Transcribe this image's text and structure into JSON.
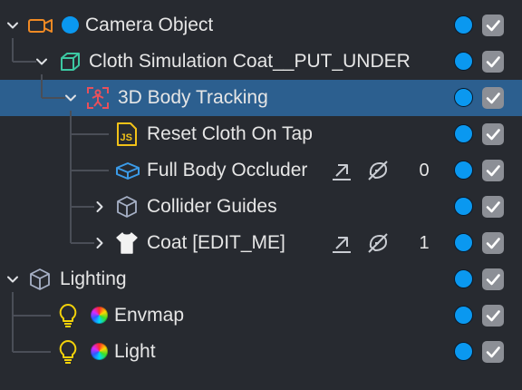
{
  "hierarchy": [
    {
      "name": "Camera Object",
      "level": 0,
      "expand": "open",
      "icon": "camera-icon",
      "name_dot": "#0a98f0",
      "visible": true,
      "enabled": true,
      "selected": false
    },
    {
      "name": "Cloth Simulation Coat__PUT_UNDER",
      "level": 1,
      "expand": "open",
      "icon": "cube-green-icon",
      "visible": true,
      "enabled": true,
      "selected": false
    },
    {
      "name": "3D Body Tracking",
      "level": 2,
      "expand": "open",
      "icon": "body-tracking-icon",
      "visible": true,
      "enabled": true,
      "selected": true
    },
    {
      "name": "Reset Cloth On Tap",
      "level": 3,
      "expand": "none",
      "icon": "js-script-icon",
      "visible": true,
      "enabled": true,
      "selected": false
    },
    {
      "name": "Full Body Occluder",
      "level": 3,
      "expand": "none",
      "icon": "cube-blue-icon",
      "visible": true,
      "enabled": true,
      "selected": false,
      "tools": true,
      "count": "0"
    },
    {
      "name": "Collider Guides",
      "level": 3,
      "expand": "closed",
      "icon": "cube-outline-icon",
      "visible": true,
      "enabled": true,
      "selected": false
    },
    {
      "name": "Coat [EDIT_ME]",
      "level": 3,
      "expand": "closed",
      "icon": "tshirt-icon",
      "visible": true,
      "enabled": true,
      "selected": false,
      "tools": true,
      "count": "1"
    },
    {
      "name": "Lighting",
      "level": 0,
      "expand": "open",
      "icon": "cube-outline-icon",
      "visible": true,
      "enabled": true,
      "selected": false
    },
    {
      "name": "Envmap",
      "level": 1,
      "expand": "none",
      "icon": "lightbulb-icon",
      "name_dot": "rainbow",
      "visible": true,
      "enabled": true,
      "selected": false
    },
    {
      "name": "Light",
      "level": 1,
      "expand": "none",
      "icon": "lightbulb-icon",
      "name_dot": "rainbow",
      "visible": true,
      "enabled": true,
      "selected": false
    }
  ]
}
